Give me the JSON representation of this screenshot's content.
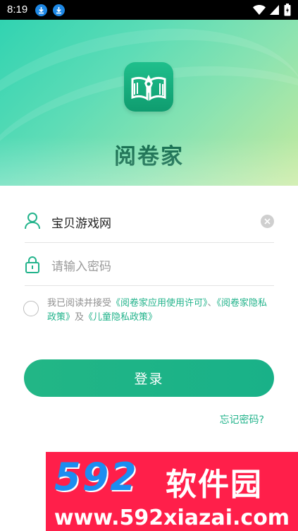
{
  "status_bar": {
    "time": "8:19"
  },
  "app": {
    "name": "阅卷家"
  },
  "login_form": {
    "username_value": "宝贝游戏网",
    "password_placeholder": "请输入密码",
    "agreement": {
      "prefix": "我已阅读并接受",
      "link1": "《阅卷家应用使用许可》",
      "sep": "、",
      "link2": "《阅卷家隐私政策》",
      "mid": "及",
      "link3": "《儿童隐私政策》"
    },
    "login_label": "登录",
    "forgot_label": "忘记密码?"
  },
  "watermark": {
    "brand": "592",
    "brand_cn": "软件园",
    "url": "www.592xiazai.com"
  },
  "colors": {
    "accent": "#22b38b",
    "header_gradient_start": "#31d3b1",
    "header_gradient_end": "#c7ea9d",
    "watermark_bg": "#ff1f4a"
  }
}
